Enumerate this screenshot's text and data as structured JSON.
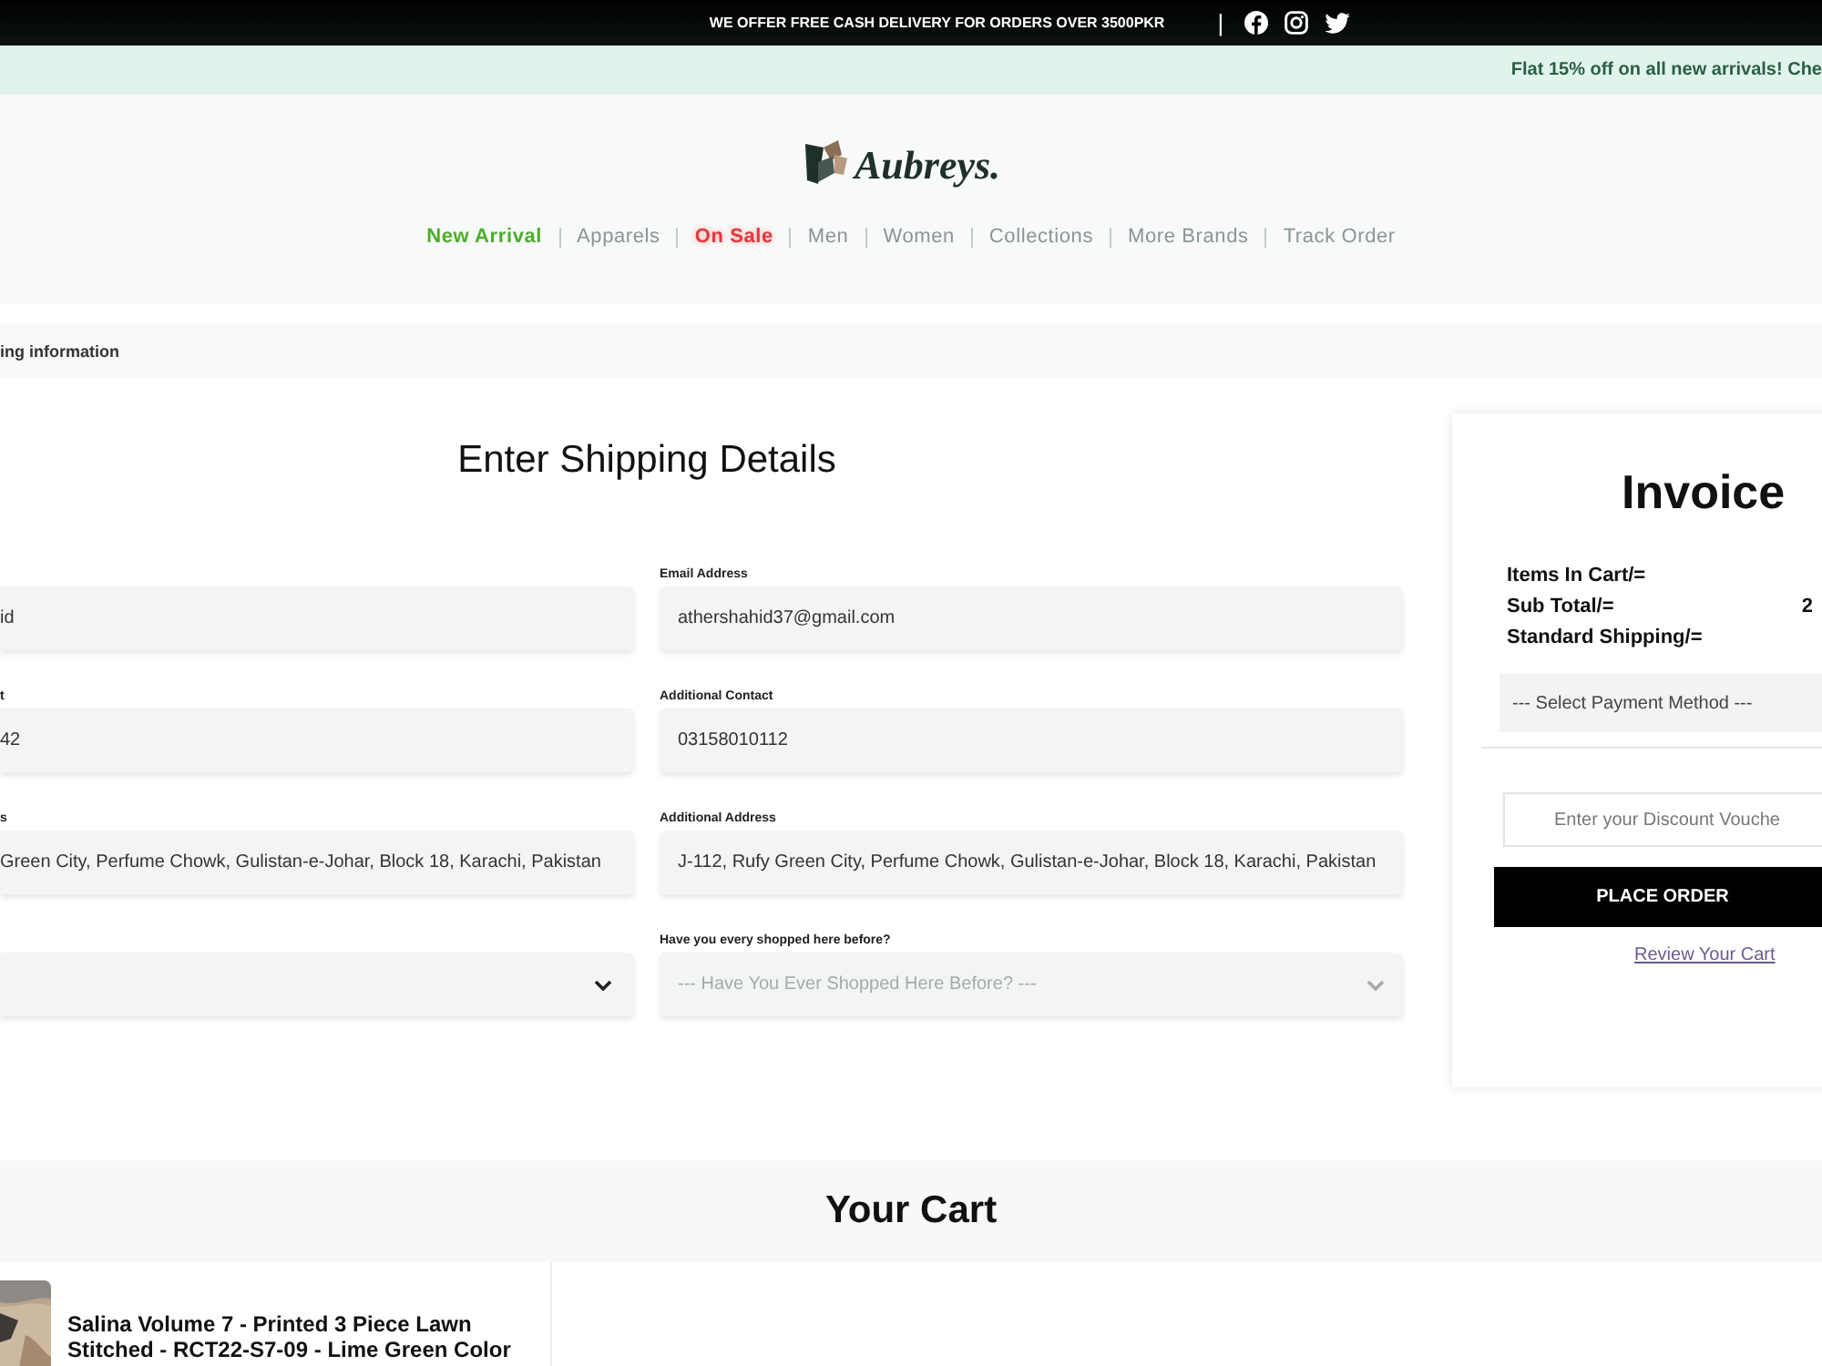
{
  "top_bar": {
    "text": "WE OFFER FREE CASH DELIVERY FOR ORDERS OVER 3500PKR",
    "divider": "|"
  },
  "promo_bar": {
    "text": "Flat 15% off on all new arrivals! Che"
  },
  "logo": {
    "text": "Aubreys."
  },
  "nav": [
    {
      "label": "New Arrival",
      "kind": "new"
    },
    {
      "label": "Apparels",
      "kind": "plain"
    },
    {
      "label": "On Sale",
      "kind": "sale"
    },
    {
      "label": "Men",
      "kind": "plain"
    },
    {
      "label": "Women",
      "kind": "plain"
    },
    {
      "label": "Collections",
      "kind": "plain"
    },
    {
      "label": "More Brands",
      "kind": "plain"
    },
    {
      "label": "Track Order",
      "kind": "plain"
    }
  ],
  "breadcrumb": "ing information",
  "form": {
    "title": "Enter Shipping Details",
    "left_fields": [
      {
        "kind": "input",
        "value": "id"
      },
      {
        "kind": "input",
        "label": "t",
        "value": "42"
      },
      {
        "kind": "input",
        "label": "s",
        "value": "Green City, Perfume Chowk, Gulistan-e-Johar, Block 18, Karachi, Pakistan"
      },
      {
        "kind": "select"
      }
    ],
    "right_fields": [
      {
        "kind": "input",
        "label": "Email Address",
        "value": "athershahid37@gmail.com"
      },
      {
        "kind": "input",
        "label": "Additional Contact",
        "value": "03158010112"
      },
      {
        "kind": "input",
        "label": "Additional Address",
        "value": "J-112, Rufy Green City, Perfume Chowk, Gulistan-e-Johar, Block 18, Karachi, Pakistan"
      },
      {
        "kind": "select",
        "label": "Have you every shopped here before?",
        "placeholder": "--- Have You Ever Shopped Here Before? ---"
      }
    ]
  },
  "invoice": {
    "title": "Invoice",
    "rows": [
      {
        "label": "Items In Cart/="
      },
      {
        "label": "Sub Total/=",
        "value": "2"
      },
      {
        "label": "Standard Shipping/="
      }
    ],
    "payment_select": {
      "placeholder": "--- Select Payment Method ---"
    },
    "voucher_field": {
      "placeholder": "Enter your Discount Vouche"
    },
    "place_order": "PLACE ORDER",
    "review_link": "Review Your Cart"
  },
  "cart": {
    "title": "Your Cart",
    "items": [
      {
        "kind": "picture",
        "title": "Salina Volume 7 - Printed 3 Piece Lawn Stitched - RCT22-S7-09 - Lime Green Color"
      }
    ]
  }
}
